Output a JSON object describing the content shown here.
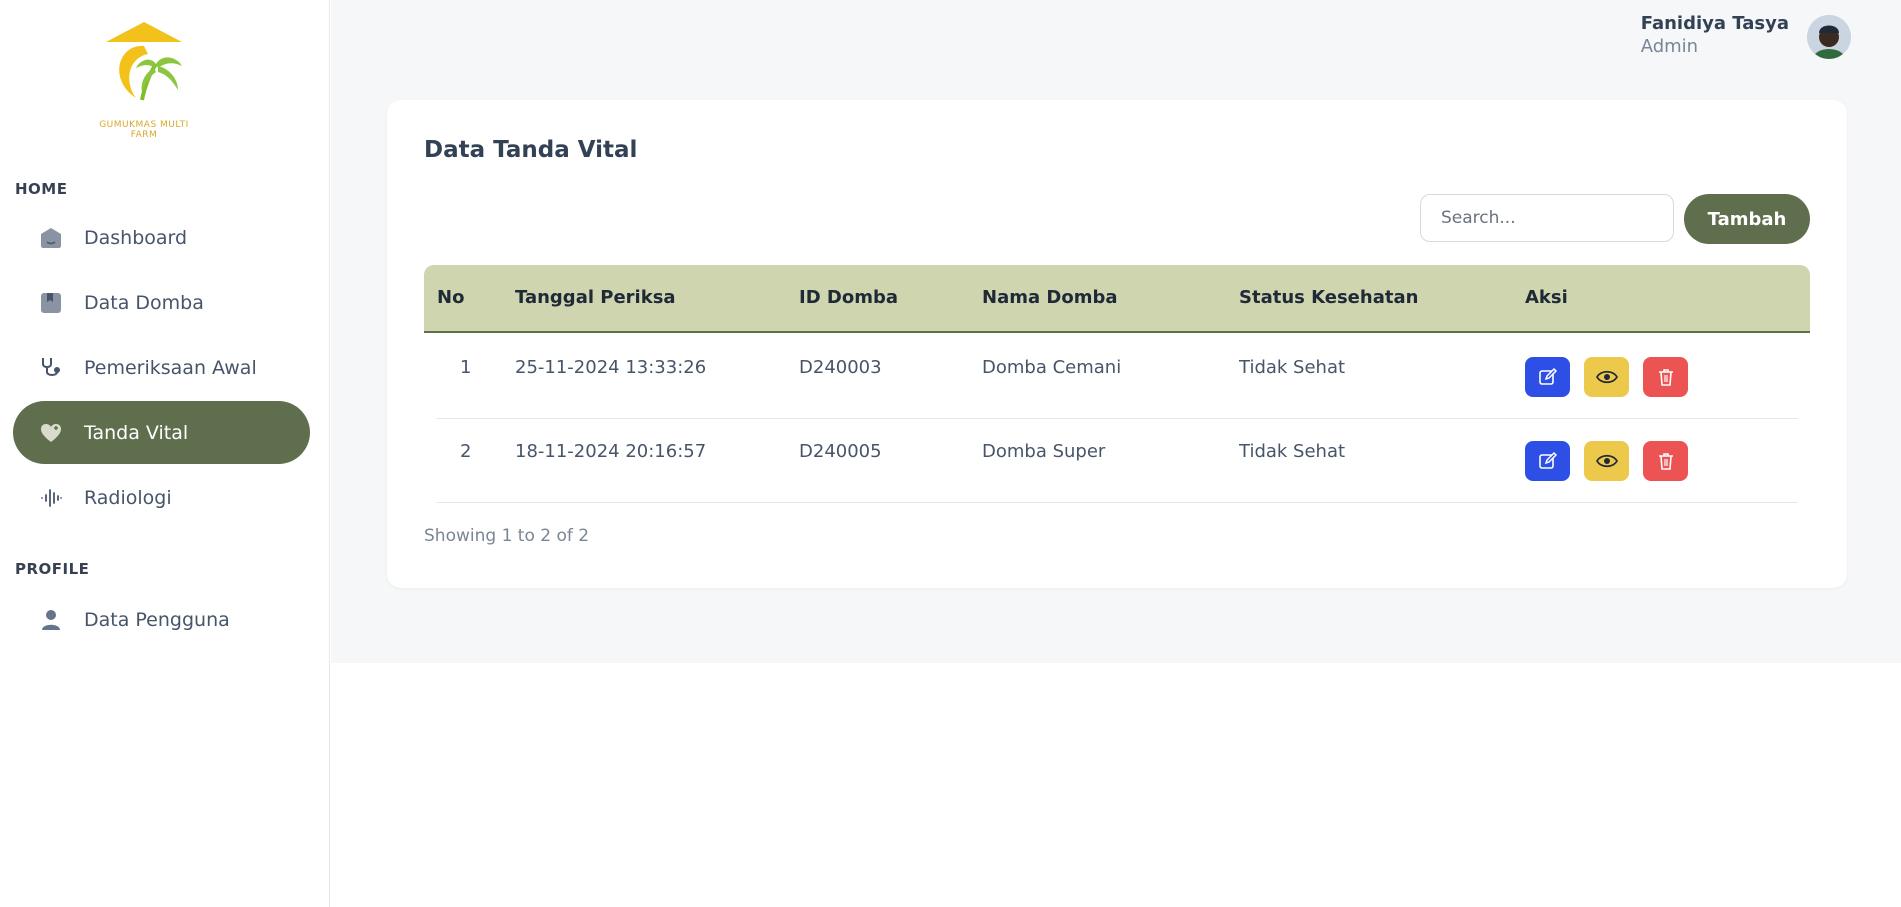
{
  "brand": {
    "logo_text": "GUMUKMAS MULTI FARM",
    "accent": "#5f6f4d"
  },
  "sidebar": {
    "sections": [
      {
        "label": "HOME"
      },
      {
        "label": "PROFILE"
      }
    ],
    "items": [
      {
        "label": "Dashboard",
        "icon": "home-icon"
      },
      {
        "label": "Data Domba",
        "icon": "bookmark-icon"
      },
      {
        "label": "Pemeriksaan Awal",
        "icon": "stethoscope-icon"
      },
      {
        "label": "Tanda Vital",
        "icon": "heart-pulse-icon",
        "active": true
      },
      {
        "label": "Radiologi",
        "icon": "waveform-icon"
      },
      {
        "label": "Data Pengguna",
        "icon": "user-icon"
      }
    ]
  },
  "header": {
    "user_name": "Fanidiya Tasya",
    "user_role": "Admin"
  },
  "main": {
    "title": "Data Tanda Vital",
    "search": {
      "placeholder": "Search...",
      "value": ""
    },
    "add_button": "Tambah",
    "table": {
      "columns": [
        "No",
        "Tanggal Periksa",
        "ID Domba",
        "Nama Domba",
        "Status Kesehatan",
        "Aksi"
      ],
      "rows": [
        {
          "no": "1",
          "tanggal": "25-11-2024 13:33:26",
          "id": "D240003",
          "nama": "Domba Cemani",
          "status": "Tidak Sehat"
        },
        {
          "no": "2",
          "tanggal": "18-11-2024 20:16:57",
          "id": "D240005",
          "nama": "Domba Super",
          "status": "Tidak Sehat"
        }
      ]
    },
    "pagination_text": "Showing 1 to 2 of 2"
  }
}
